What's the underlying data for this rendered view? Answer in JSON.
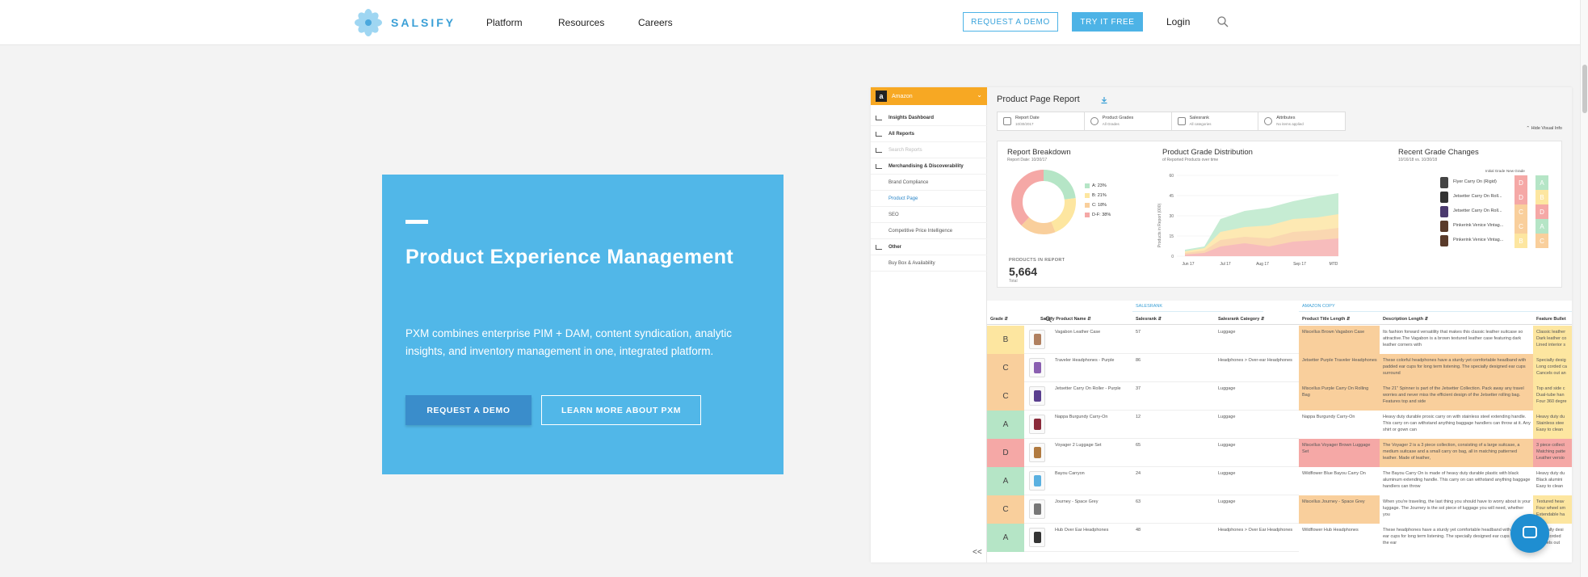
{
  "header": {
    "brand": "SALSIFY",
    "nav": [
      "Platform",
      "Resources",
      "Careers"
    ],
    "request_demo": "REQUEST A DEMO",
    "try_free": "TRY IT FREE",
    "login": "Login"
  },
  "hero": {
    "title": "Product Experience Management",
    "body": "PXM combines enterprise PIM + DAM, content syndication, analytic insights, and inventory management in one, integrated platform.",
    "primary_cta": "REQUEST A DEMO",
    "secondary_cta": "LEARN MORE ABOUT PXM"
  },
  "app": {
    "account": "Amazon",
    "sidebar": [
      {
        "label": "Insights Dashboard",
        "bold": true,
        "icon": true
      },
      {
        "label": "All Reports",
        "bold": true,
        "icon": true
      },
      {
        "label": "Search Reports",
        "bold": false,
        "icon": true,
        "placeholder": true
      },
      {
        "label": "Merchandising & Discoverability",
        "bold": true,
        "icon": true
      },
      {
        "label": "Brand Compliance",
        "sub": true
      },
      {
        "label": "Product Page",
        "sub": true,
        "active": true
      },
      {
        "label": "SEO",
        "sub": true
      },
      {
        "label": "Competitive Price Intelligence",
        "sub": true
      },
      {
        "label": "Other",
        "bold": true,
        "icon": true
      },
      {
        "label": "Buy Box & Availability",
        "sub": true
      }
    ],
    "collapse": "<<",
    "report_title": "Product Page Report",
    "filters": [
      {
        "title": "Report Date",
        "value": "10/30/2017"
      },
      {
        "title": "Product Grades",
        "value": "All Grades"
      },
      {
        "title": "Salesrank",
        "value": "All categories"
      },
      {
        "title": "Attributes",
        "value": "No items applied"
      }
    ],
    "hide_info": "Hide Visual Info",
    "breakdown": {
      "title": "Report Breakdown",
      "date": "Report Date: 10/30/17",
      "legend": [
        "A: 23%",
        "B: 21%",
        "C: 18%",
        "D-F: 38%"
      ],
      "products_label": "PRODUCTS IN REPORT",
      "products_count": "5,664",
      "total": "Total"
    },
    "distribution": {
      "title": "Product Grade Distribution",
      "sub": "of Reported Products over time",
      "ylabel": "Products in Report (000)",
      "yticks": [
        "60",
        "45",
        "30",
        "15",
        "0"
      ],
      "xticks": [
        "Jun 17",
        "Jul 17",
        "Aug 17",
        "Sep 17",
        "MTD"
      ]
    },
    "recent": {
      "title": "Recent Grade Changes",
      "sub": "10/16/18 vs. 10/30/18",
      "initial_label": "Initial Grade",
      "new_label": "New Grade",
      "rows": [
        {
          "name": "Flyer Carry On (Rigid)",
          "from": "D",
          "to": "A"
        },
        {
          "name": "Jetsetter Carry On Roll...",
          "from": "D",
          "to": "B"
        },
        {
          "name": "Jetsetter Carry On Roll...",
          "from": "C",
          "to": "D"
        },
        {
          "name": "Pinkerink Venice Vintag...",
          "from": "C",
          "to": "A"
        },
        {
          "name": "Pinkerink Venice Vintag...",
          "from": "B",
          "to": "C"
        }
      ]
    },
    "table": {
      "groups": [
        "SALESRANK",
        "AMAZON COPY"
      ],
      "headers": [
        "Grade",
        "Salsify Product Name",
        "Salesrank",
        "Salesrank Category",
        "Product Title Length",
        "Description Length",
        "Feature Bullet"
      ],
      "rows": [
        {
          "grade": "B",
          "name": "Vagabon Leather Case",
          "rank": "57",
          "cat": "Luggage",
          "title": "Miscellus Brown Vagabon Case",
          "desc": "Its fashion forward versatility that makes this classic leather suitcase so attractive.The Vagabon is a brown textured leather case featuring dark leather corners with",
          "feat": "Classic leather Dark leather co Lined interior s"
        },
        {
          "grade": "C",
          "name": "Traveler Headphones - Purple",
          "rank": "86",
          "cat": "Headphones > Over-ear Headphones",
          "title": "Jetsetter Purple Traveler Headphones",
          "desc": "These colorful headphones have a sturdy yet comfortable headband with padded ear cups for long term listening. The specially designed ear cups surround",
          "feat": "Specially desig Long corded ca Cancels out an"
        },
        {
          "grade": "C",
          "name": "Jetsetter Carry On Roller - Purple",
          "rank": "37",
          "cat": "Luggage",
          "title": "Miscellus Purple Carry On Rolling Bag",
          "desc": "The 21\" Spinner is part of the Jetsetter Collection. Pack away any travel worries and never miss the efficient design of the Jetsetter rolling bag. Features top and side",
          "feat": "Top and side c Dual-tube han Four 360 degre"
        },
        {
          "grade": "A",
          "name": "Nappa Burgundy Carry-On",
          "rank": "12",
          "cat": "Luggage",
          "title": "Nappa Burgundy Carry-On",
          "desc": "Heavy duty durable prosic carry on with stainless steel extending handle. This carry on can withstand anything baggage handlers can throw at it. Any shirt or gown can",
          "feat": "Heavy duty du Stainless stee Easy to clean"
        },
        {
          "grade": "D",
          "name": "Voyager 2 Luggage Set",
          "rank": "65",
          "cat": "Luggage",
          "title": "Miscellus Voyager Brown Luggage Set",
          "desc": "The Voyager 2 is a 3 piece collection, consisting of a large suitcase, a medium suitcase and a small carry on bag, all in matching patterned leather. Made of leather,",
          "feat": "3 piece collect Matching patte Leather versio"
        },
        {
          "grade": "A",
          "name": "Bayou Carryon",
          "rank": "24",
          "cat": "Luggage",
          "title": "Wildflower Blue Bayou Carry On",
          "desc": "The Bayou Carry On is made of heavy duty durable plastic with black aluminum extending handle. This carry on can withstand anything baggage handlers can throw",
          "feat": "Heavy duty du Black alumini Easy to clean"
        },
        {
          "grade": "C",
          "name": "Journey - Space Grey",
          "rank": "63",
          "cat": "Luggage",
          "title": "Miscellus Journey - Space Grey",
          "desc": "When you're traveling, the last thing you should have to worry about is your luggage. The Journey is the sol piece of luggage you will need, whether you",
          "feat": "Textured heav Four wheel sm Extendable ha"
        },
        {
          "grade": "A",
          "name": "Hub Over Ear Headphones",
          "rank": "48",
          "cat": "Headphones > Over Ear Headphones",
          "title": "Wildflower Hub Headphones",
          "desc": "These headphones have a sturdy yet comfortable headband with padded ear cups for long term listening. The specially designed ear cups surround the ear",
          "feat": "Specially desi Long corded Cancels out"
        }
      ]
    }
  },
  "colors": {
    "accent": "#51b7e8",
    "gradeA": "#b5e5c6",
    "gradeB": "#fde6a0",
    "gradeC": "#f9cf9c",
    "gradeD": "#f5a8a6"
  }
}
